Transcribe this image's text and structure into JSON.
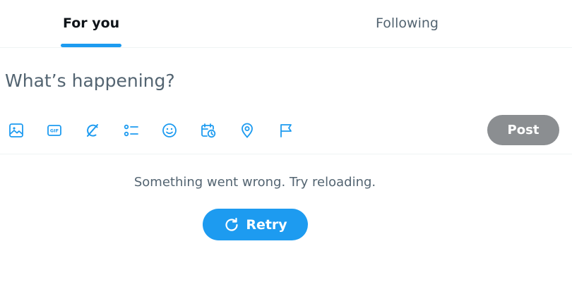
{
  "tabs": [
    {
      "label": "For you",
      "active": true
    },
    {
      "label": "Following",
      "active": false
    }
  ],
  "composer": {
    "placeholder": "What’s happening?",
    "value": "",
    "tools": [
      "image-icon",
      "gif-icon",
      "grok-icon",
      "poll-icon",
      "emoji-icon",
      "schedule-icon",
      "location-icon",
      "flag-icon"
    ],
    "post_label": "Post"
  },
  "feed": {
    "error_message": "Something went wrong. Try reloading.",
    "retry_label": "Retry"
  },
  "colors": {
    "accent": "#1d9bf0",
    "post_disabled": "#8b8e91",
    "muted_text": "#536471"
  }
}
